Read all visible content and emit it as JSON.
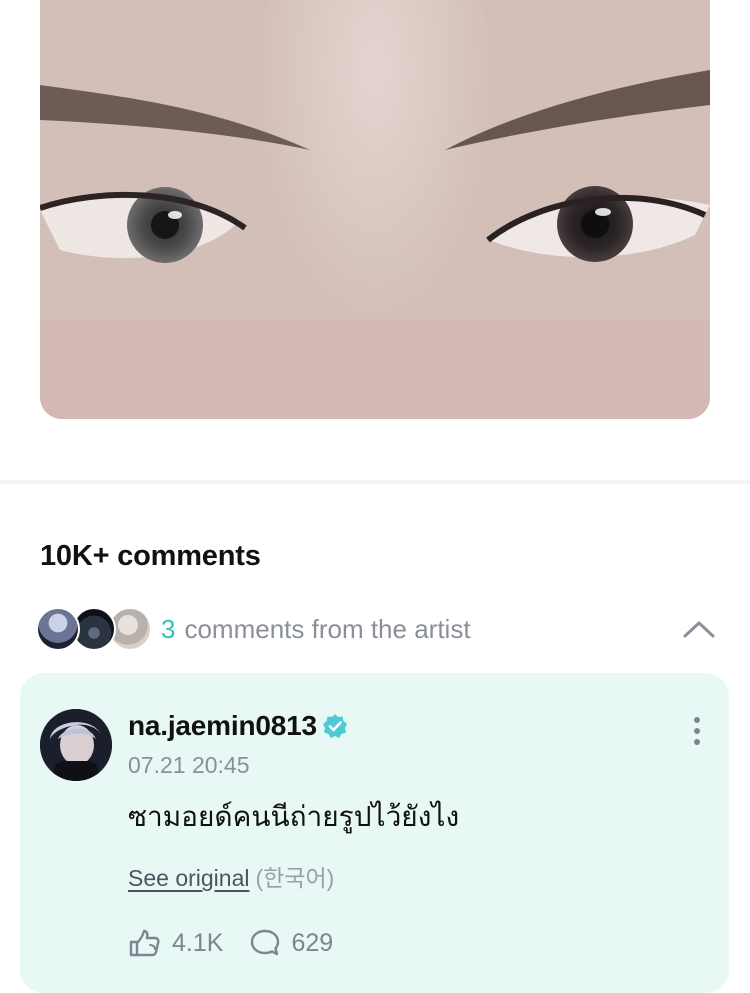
{
  "post": {
    "photo_description_icon": "post-photo"
  },
  "comments": {
    "title": "10K+ comments",
    "artist_summary": {
      "count": "3",
      "label": "comments from the artist",
      "toggle_icon": "chevron-up-icon"
    }
  },
  "artist_comment": {
    "author": "na.jaemin0813",
    "verified_icon": "verified-badge-icon",
    "time": "07.21 20:45",
    "text": "ซามอยด์คนนีถ่ายรูปไว้ยังไง",
    "see_original_label": "See original",
    "original_language": "(한국어)",
    "likes": "4.1K",
    "replies": "629",
    "like_icon": "like-hand-icon",
    "reply_icon": "reply-bubble-icon",
    "more_icon": "more-vertical-icon"
  },
  "colors": {
    "accent": "#2ec4b6",
    "card_background": "#e8f8f5",
    "muted_text": "#8a8f98"
  }
}
